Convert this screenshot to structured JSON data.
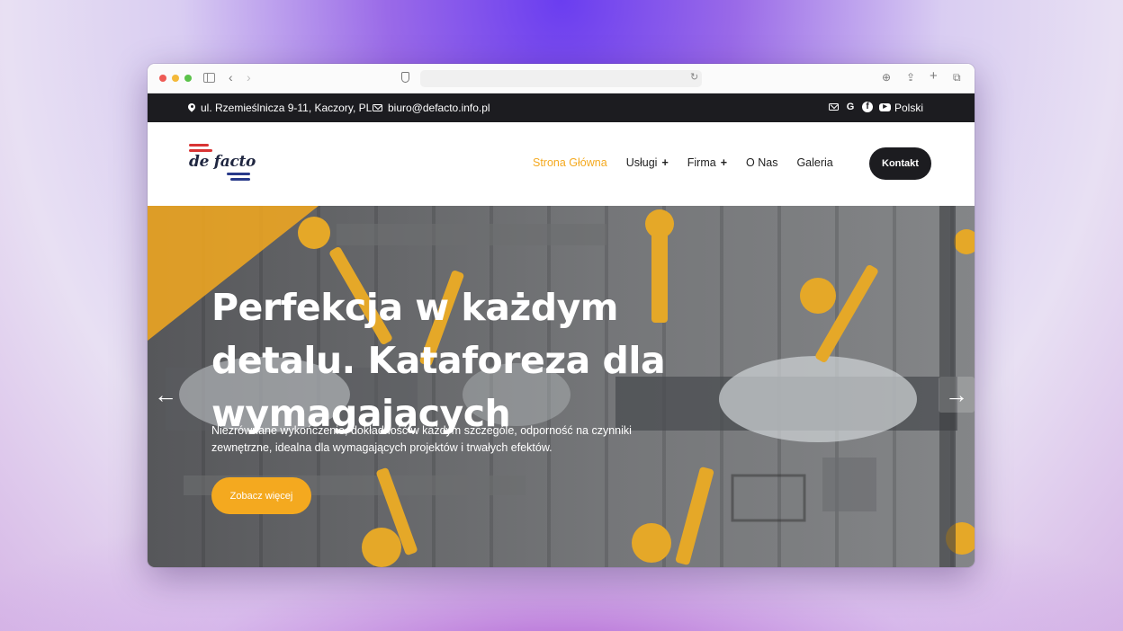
{
  "browser": {
    "url": "",
    "icons": [
      "sidebar-icon",
      "back-icon",
      "forward-icon",
      "shield-icon",
      "reload-icon",
      "download-icon",
      "share-icon",
      "new-tab-icon",
      "tabs-icon"
    ]
  },
  "topbar": {
    "address": "ul. Rzemieślnicza 9-11, Kaczory, PL",
    "email": "biuro@defacto.info.pl",
    "language": "Polski",
    "social": [
      "mail-icon",
      "google-icon",
      "facebook-icon",
      "youtube-icon"
    ]
  },
  "header": {
    "logo_text": "de facto",
    "nav": [
      {
        "label": "Strona Główna",
        "active": true,
        "has_submenu": false
      },
      {
        "label": "Usługi",
        "active": false,
        "has_submenu": true
      },
      {
        "label": "Firma",
        "active": false,
        "has_submenu": true
      },
      {
        "label": "O Nas",
        "active": false,
        "has_submenu": false
      },
      {
        "label": "Galeria",
        "active": false,
        "has_submenu": false
      }
    ],
    "submenu_glyph": "+",
    "contact_label": "Kontakt"
  },
  "hero": {
    "headline": "Perfekcja w każdym detalu. Kataforeza dla wymagających",
    "subtext": "Niezrównane wykończenie, dokładność w każdym szczególe, odporność na czynniki zewnętrzne, idealna dla wymagających projektów i trwałych efektów.",
    "cta_label": "Zobacz więcej",
    "prev_arrow": "←",
    "next_arrow": "→"
  },
  "colors": {
    "accent": "#f4a91f",
    "dark": "#1c1c20",
    "logo_red": "#d93434",
    "logo_blue": "#283a8a"
  }
}
